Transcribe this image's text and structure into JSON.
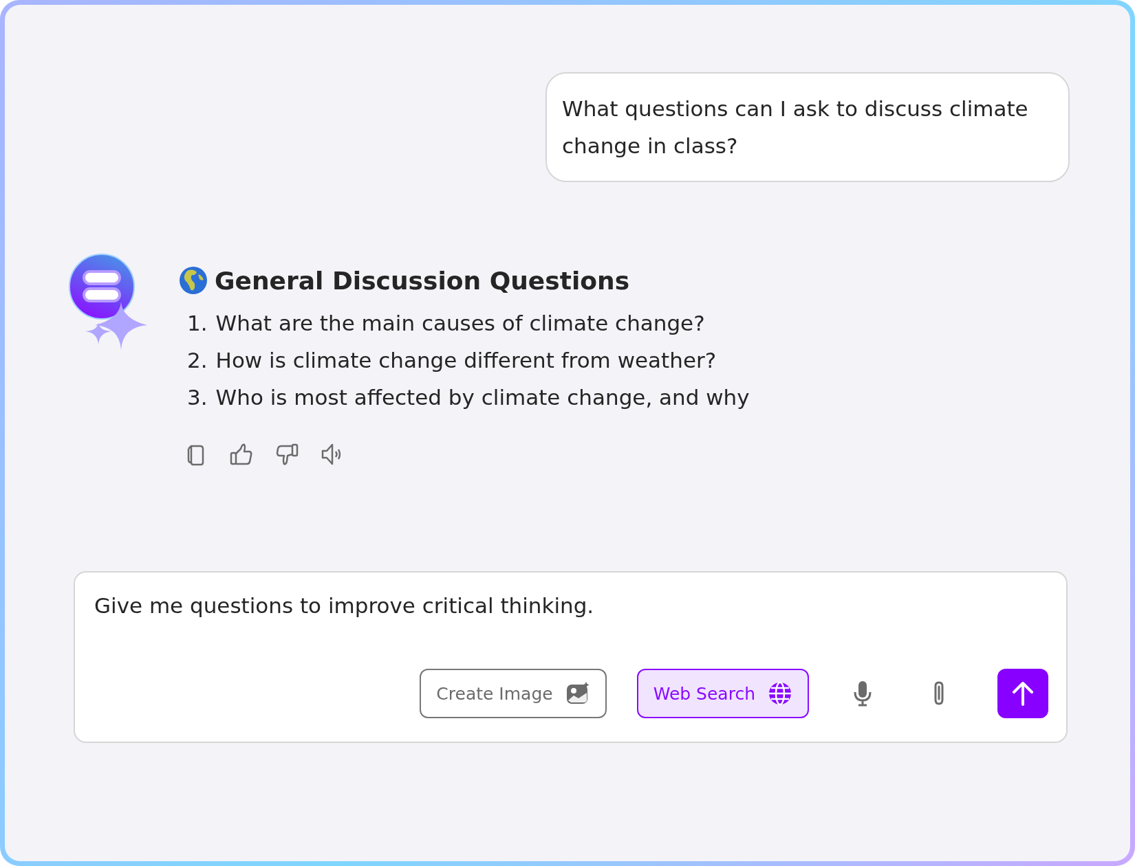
{
  "user_message": {
    "text": "What questions can I ask to discuss climate change in class?"
  },
  "response": {
    "heading": "General Discussion Questions",
    "items": [
      {
        "number": "1.",
        "text": "What are the main causes of climate change?"
      },
      {
        "number": "2.",
        "text": "How is climate change different from weather?"
      },
      {
        "number": "3.",
        "text": "Who is most affected by climate change, and why"
      }
    ]
  },
  "composer": {
    "value": "Give me questions to improve critical thinking.",
    "tools": [
      {
        "kind": "image",
        "label": "Create Image",
        "selected": false
      },
      {
        "kind": "web",
        "label": "Web Search",
        "selected": true
      }
    ]
  }
}
